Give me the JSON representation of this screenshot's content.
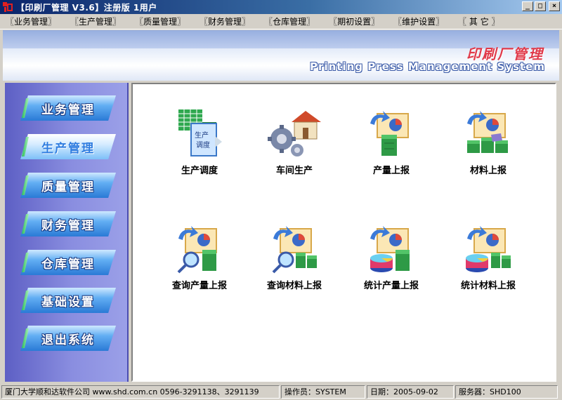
{
  "window": {
    "title": "【印刷厂管理 V3.6】注册版 1用户",
    "minimize_label": "_",
    "maximize_label": "□",
    "close_label": "×"
  },
  "menu": [
    "〖业务管理〗",
    "〖生产管理〗",
    "〖质量管理〗",
    "〖财务管理〗",
    "〖仓库管理〗",
    "〖期初设置〗",
    "〖维护设置〗",
    "〖 其 它 〗"
  ],
  "banner": {
    "title_cn": "印刷厂管理",
    "title_en": "Printing Press Management System"
  },
  "sidebar": {
    "items": [
      {
        "label": "业务管理",
        "active": false
      },
      {
        "label": "生产管理",
        "active": true
      },
      {
        "label": "质量管理",
        "active": false
      },
      {
        "label": "财务管理",
        "active": false
      },
      {
        "label": "仓库管理",
        "active": false
      },
      {
        "label": "基础设置",
        "active": false
      },
      {
        "label": "退出系统",
        "active": false
      }
    ]
  },
  "main": {
    "tiles": [
      {
        "label": "生产调度",
        "icon": "production-schedule-icon",
        "icon_text_1": "生产",
        "icon_text_2": "调度"
      },
      {
        "label": "车间生产",
        "icon": "workshop-production-icon"
      },
      {
        "label": "产量上报",
        "icon": "output-report-icon"
      },
      {
        "label": "材料上报",
        "icon": "material-report-icon"
      },
      {
        "label": "查询产量上报",
        "icon": "query-output-report-icon"
      },
      {
        "label": "查询材料上报",
        "icon": "query-material-report-icon"
      },
      {
        "label": "统计产量上报",
        "icon": "stats-output-report-icon"
      },
      {
        "label": "统计材料上报",
        "icon": "stats-material-report-icon"
      }
    ]
  },
  "status": {
    "company": "厦门大学顺和达软件公司 www.shd.com.cn 0596-3291138、3291139",
    "operator": "操作员：SYSTEM",
    "date": "日期：2005-09-02",
    "server": "服务器：SHD100"
  },
  "colors": {
    "title_bar": "#0a246a",
    "sidebar": "#7a7dd8",
    "banner_cn": "#e03a4a",
    "button_blue": "#2a7ad6"
  }
}
